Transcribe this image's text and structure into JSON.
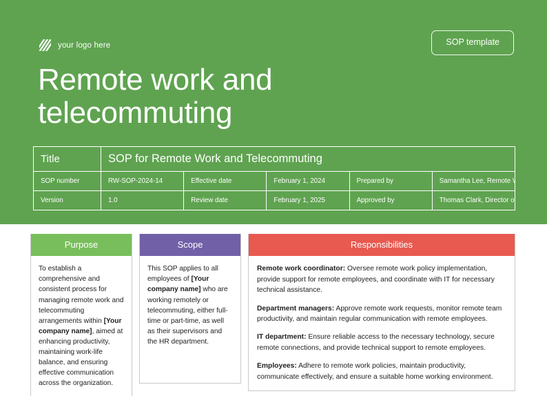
{
  "hero": {
    "logo": {
      "icon": "hatched-square-logo-icon",
      "text": "your logo here"
    },
    "badge_label": "SOP template",
    "title": "Remote work and telecommuting",
    "background_color": "#5fa350"
  },
  "meta_table": {
    "title_label": "Title",
    "title_value": "SOP for Remote Work and Telecommuting",
    "rows": [
      {
        "label1": "SOP number",
        "value1": "RW-SOP-2024-14",
        "label2": "Effective date",
        "value2": "February 1, 2024",
        "label3": "Prepared by",
        "value3": "Samantha Lee, Remote Work Coordinator"
      },
      {
        "label1": "Version",
        "value1": "1.0",
        "label2": "Review date",
        "value2": "February 1, 2025",
        "label3": "Approved by",
        "value3": "Thomas Clark, Director of Operations"
      }
    ]
  },
  "cards": {
    "purpose": {
      "heading": "Purpose",
      "heading_color": "#79be5c",
      "text_before": "To establish a comprehensive and consistent process for managing remote work and telecommuting arrangements within ",
      "placeholder": "[Your company name]",
      "text_after": ", aimed at enhancing productivity, maintaining work-life balance, and ensuring effective communication across the organization."
    },
    "scope": {
      "heading": "Scope",
      "heading_color": "#7160a8",
      "text_before": "This SOP applies to all employees of ",
      "placeholder": "[Your company name]",
      "text_after": " who are working remotely or telecommuting, either full-time or part-time, as well as their supervisors and the HR department."
    },
    "responsibilities": {
      "heading": "Responsibilities",
      "heading_color": "#e8594f",
      "items": [
        {
          "role": "Remote work coordinator:",
          "text": " Oversee remote work policy implementation, provide support for remote employees, and coordinate with IT for necessary technical assistance."
        },
        {
          "role": "Department managers:",
          "text": " Approve remote work requests, monitor remote team productivity, and maintain regular communication with remote employees."
        },
        {
          "role": "IT department:",
          "text": " Ensure reliable access to the necessary technology, secure remote connections, and provide technical support to remote employees."
        },
        {
          "role": "Employees:",
          "text": " Adhere to remote work policies, maintain productivity, communicate effectively, and ensure a suitable home working environment."
        }
      ]
    }
  }
}
